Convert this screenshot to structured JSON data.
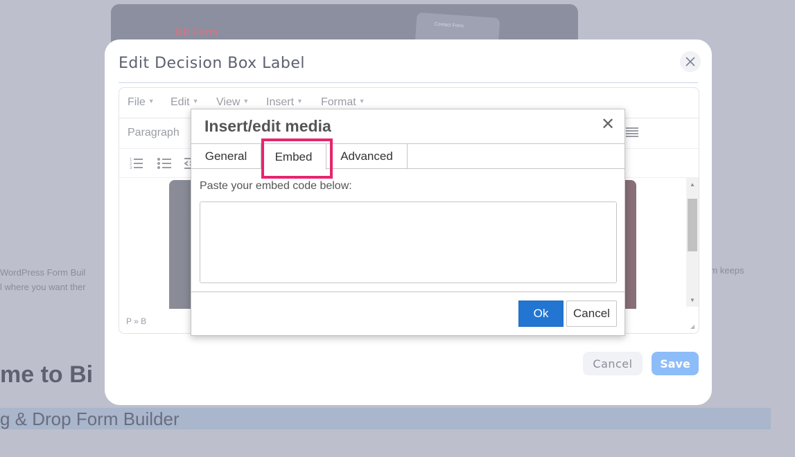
{
  "background": {
    "logo_text": "Bit Form",
    "thumb_text": "Contact Form",
    "left_text_line1": "WordPress Form Buil",
    "left_text_line2": "l where you want ther",
    "right_text": "rm keeps",
    "heading": "me to Bi",
    "subheading": "g & Drop Form Builder"
  },
  "modal": {
    "title": "Edit Decision Box Label",
    "cancel_label": "Cancel",
    "save_label": "Save"
  },
  "editor": {
    "menu": [
      {
        "label": "File"
      },
      {
        "label": "Edit"
      },
      {
        "label": "View"
      },
      {
        "label": "Insert"
      },
      {
        "label": "Format"
      }
    ],
    "block_format": "Paragraph",
    "status_path": "P » B"
  },
  "media_dialog": {
    "title": "Insert/edit media",
    "close_glyph": "✕",
    "tabs": [
      {
        "label": "General"
      },
      {
        "label": "Embed",
        "active": true
      },
      {
        "label": "Advanced"
      }
    ],
    "embed_label": "Paste your embed code below:",
    "embed_value": "",
    "ok_label": "Ok",
    "cancel_label": "Cancel"
  },
  "colors": {
    "primary": "#2276d2",
    "highlight": "#e6256e",
    "save_button": "#8dbdf8"
  }
}
